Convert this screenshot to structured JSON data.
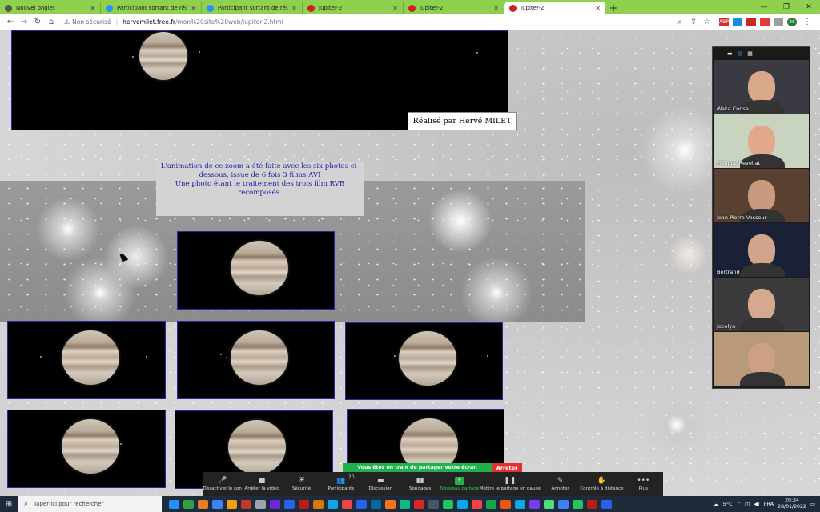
{
  "browser": {
    "tabs": [
      {
        "label": "Nouvel onglet",
        "color": "#555555",
        "active": false
      },
      {
        "label": "Participant sortant de réunion - Z",
        "color": "#2d8cff",
        "active": false
      },
      {
        "label": "Participant sortant de réunion - Z",
        "color": "#2d8cff",
        "active": false
      },
      {
        "label": "Jupiter-2",
        "color": "#cc2222",
        "active": false
      },
      {
        "label": "Jupiter-2",
        "color": "#cc2222",
        "active": false
      },
      {
        "label": "Jupiter-2",
        "color": "#cc2222",
        "active": true
      }
    ],
    "new_tab": "+",
    "security_label": "Non sécurisé",
    "url_host": "hervemilet.free.fr",
    "url_path": "/mon%20site%20web/jupiter-2.html",
    "profile_initial": "H"
  },
  "page": {
    "credit": "Réalisé par Hervé MILET",
    "caption_lines": [
      "L'animation de ce zoom a été faite avec les six photos ci-",
      "dessous, issue de 6 fois 3 films AVI",
      "Une photo étant le traitement des  trois film RVB",
      "recomposés."
    ]
  },
  "participants": [
    {
      "name": "Waka Conse",
      "bg": "#3a3a42",
      "face": "#d9a88a"
    },
    {
      "name": "Philippe Revellat",
      "bg": "#c9d4c0",
      "face": "#e0a98c"
    },
    {
      "name": "Jean Pierre Vasseur",
      "bg": "#5a4030",
      "face": "#c89a80"
    },
    {
      "name": "Bertrand",
      "bg": "#1a2036",
      "face": "#d1a58c"
    },
    {
      "name": "Jocelyn",
      "bg": "#3b3b3b",
      "face": "#d7a890"
    },
    {
      "name": "",
      "bg": "#b89a7a",
      "face": "#cf9f84"
    }
  ],
  "zoom": {
    "share_banner": "Vous êtes en train de partager votre écran",
    "stop_label": "Arrêter",
    "participants_count": "20",
    "buttons": [
      {
        "label": "Désactiver le son",
        "icon": "🎤",
        "name": "mute-button"
      },
      {
        "label": "Arrêter la vidéo",
        "icon": "■",
        "name": "stop-video-button"
      },
      {
        "label": "Sécurité",
        "icon": "⛨",
        "name": "security-button"
      },
      {
        "label": "Participants",
        "icon": "👥",
        "name": "participants-button"
      },
      {
        "label": "Discussion",
        "icon": "▬",
        "name": "chat-button"
      },
      {
        "label": "Sondages",
        "icon": "▮▮",
        "name": "polls-button"
      },
      {
        "label": "Nouveau partage",
        "icon": "↑",
        "name": "new-share-button"
      },
      {
        "label": "Mettre le partage en pause",
        "icon": "❚❚",
        "name": "pause-share-button"
      },
      {
        "label": "Annoter",
        "icon": "✎",
        "name": "annotate-button"
      },
      {
        "label": "Contrôle à distance",
        "icon": "✋",
        "name": "remote-control-button"
      },
      {
        "label": "Plus",
        "icon": "•••",
        "name": "more-button"
      }
    ]
  },
  "taskbar": {
    "search_placeholder": "Taper ici pour rechercher",
    "weather": "5°C",
    "lang": "FRA",
    "time": "20:34",
    "date": "28/01/2022",
    "app_colors": [
      "#1e90ff",
      "#2f9e44",
      "#e67e22",
      "#3b82f6",
      "#f59e0b",
      "#c0392b",
      "#9ca3af",
      "#6d28d9",
      "#2563eb",
      "#b91c1c",
      "#d97706",
      "#0ea5e9",
      "#ef4444",
      "#2563eb",
      "#0369a1",
      "#f97316",
      "#10b981",
      "#dc2626",
      "#4b5563",
      "#22c55e",
      "#0ea5e9",
      "#ef4444",
      "#16a34a",
      "#ea580c",
      "#0ea5e9",
      "#7c3aed",
      "#4ade80",
      "#3b82f6",
      "#22c55e",
      "#b91c1c",
      "#2563eb"
    ]
  }
}
